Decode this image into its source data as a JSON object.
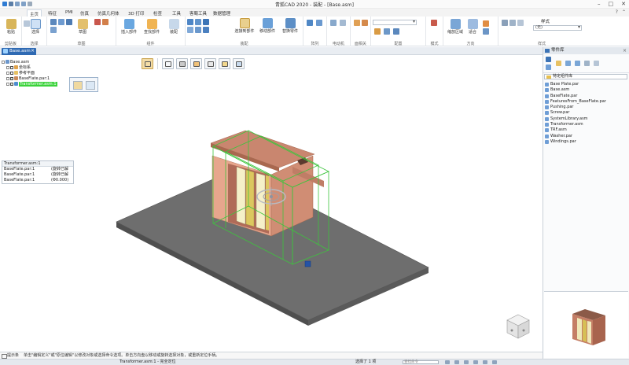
{
  "titlebar": {
    "title": "青狐CAD 2020 - 装配 - [Base.asm]",
    "window_controls": [
      "minimize-icon",
      "restore-icon",
      "close-icon"
    ]
  },
  "ribbon_tabs": {
    "tabs": [
      "主页",
      "特征",
      "PMI",
      "仿真",
      "仿真几何体",
      "3D 打印",
      "检查",
      "工具",
      "客蜀工具",
      "数据管理"
    ],
    "active": "主页"
  },
  "ribbon": {
    "groups": [
      {
        "label": "剪贴板",
        "buttons": [
          "粘贴"
        ]
      },
      {
        "label": "选择",
        "buttons": [
          "选择"
        ]
      },
      {
        "label": "草图",
        "buttons": [
          "草图"
        ]
      },
      {
        "label": "组件",
        "buttons": [
          "插入部件",
          "查找部件",
          "装配"
        ]
      },
      {
        "label": "装配",
        "buttons": [
          "连接到部件",
          "移动部件",
          "替换零件"
        ]
      },
      {
        "label": "阵列",
        "buttons": []
      },
      {
        "label": "电动机",
        "buttons": []
      },
      {
        "label": "面相关",
        "buttons": []
      },
      {
        "label": "配置",
        "buttons": []
      },
      {
        "label": "模式",
        "buttons": []
      },
      {
        "label": "方向",
        "buttons": [
          "缩放区域",
          "适合"
        ]
      },
      {
        "label": "样式",
        "buttons": [
          "样式"
        ]
      }
    ],
    "style_combo_value": "(无)",
    "config_combo_value": ""
  },
  "document": {
    "tab_label": "Base.asm"
  },
  "view_toolbar": {
    "buttons": [
      "select-mode-icon",
      "box-select-icon",
      "part-icon",
      "subassembly-icon",
      "sketch-icon",
      "reference-icon",
      "dimension-icon"
    ]
  },
  "pathfinder": {
    "rows": [
      {
        "label": "Base.asm",
        "indent": 0,
        "selected": false
      },
      {
        "label": "坐标系",
        "indent": 1,
        "selected": false
      },
      {
        "label": "参考平面",
        "indent": 1,
        "selected": false
      },
      {
        "label": "BaseFlate.par:1",
        "indent": 1,
        "selected": false
      },
      {
        "label": "Transformer.asm:1",
        "indent": 1,
        "selected": true
      }
    ]
  },
  "selection_list": {
    "header": "Transformer.asm:1",
    "rows": [
      {
        "name": "BaseFlate.par:1",
        "status": "(旋转已解"
      },
      {
        "name": "BaseFlate.par:1",
        "status": "(旋转已解"
      },
      {
        "name": "BaseFlate.par:1",
        "status": "(Φ0.000)"
      }
    ]
  },
  "command_bar": {
    "label": "提示条",
    "message": "单击\"编辑定义\"或\"原位编辑\"以修改对象或选择命令选项。单击方向盘以移动或旋转选择对象，或重新定位手柄。"
  },
  "status_bar": {
    "document": "Transformer.asm:1 - 完全定位",
    "selection": "选择了 1 项",
    "find_placeholder": "查找命令"
  },
  "library": {
    "title": "零件库",
    "path": "特定组件库",
    "items": [
      "Base Plate.par",
      "Base.asm",
      "BaseFlate.par",
      "FeaturesFrom_BaseFlate.par",
      "Pushing.par",
      "Screw.par",
      "SystemLibrary.asm",
      "Transformer.asm",
      "TRF.asm",
      "Washer.par",
      "Windings.par"
    ]
  },
  "colors": {
    "accent": "#2f6ab3",
    "selection_green": "#3bd33b",
    "plate": "#8a8a8a",
    "transformer_body": "#e9a58a"
  }
}
